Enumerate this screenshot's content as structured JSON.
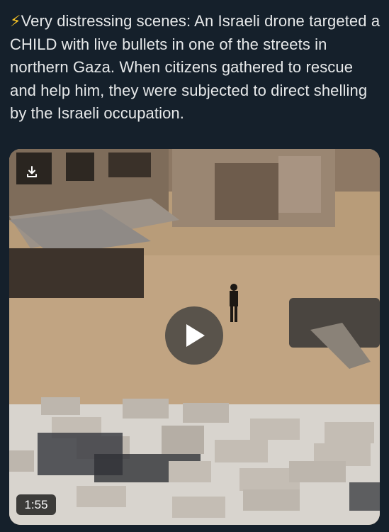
{
  "post": {
    "icon": "lightning-icon",
    "text": "Very distressing scenes: An Israeli drone targeted a CHILD with live bullets in one of the streets in northern Gaza. When citizens gathered to rescue and help him, they were subjected to direct shelling by the Israeli occupation."
  },
  "media": {
    "type": "video",
    "duration": "1:55",
    "icons": {
      "download": "download-icon",
      "play": "play-icon"
    },
    "colors": {
      "ground": "#b49a7a",
      "buildings": "#8a7560",
      "overlay": "#000000"
    }
  }
}
